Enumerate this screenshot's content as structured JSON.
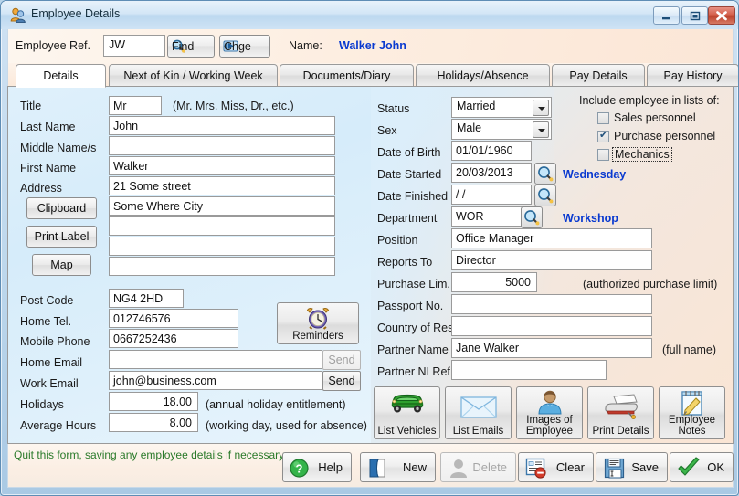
{
  "window": {
    "title": "Employee Details",
    "icon": "employees-icon",
    "controls": {
      "minimize": "minimize-icon",
      "maximize": "maximize-icon",
      "close": "close-icon"
    }
  },
  "header": {
    "employee_ref_label": "Employee Ref.",
    "employee_ref_value": "JW",
    "find_label": "Find",
    "chge_label": "Chge",
    "name_label": "Name:",
    "name_value": "Walker John"
  },
  "tabs": [
    {
      "label": "Details",
      "active": true
    },
    {
      "label": "Next of Kin / Working Week",
      "active": false
    },
    {
      "label": "Documents/Diary",
      "active": false
    },
    {
      "label": "Holidays/Absence",
      "active": false
    },
    {
      "label": "Pay Details",
      "active": false
    },
    {
      "label": "Pay History",
      "active": false
    }
  ],
  "left": {
    "title_label": "Title",
    "title_value": "Mr",
    "title_hint": "(Mr. Mrs. Miss, Dr., etc.)",
    "last_name_label": "Last Name",
    "last_name_value": "John",
    "middle_names_label": "Middle Name/s",
    "middle_names_value": "",
    "first_name_label": "First Name",
    "first_name_value": "Walker",
    "address_label": "Address",
    "address_lines": [
      "21 Some street",
      "Some Where City",
      "",
      "",
      ""
    ],
    "clipboard_label": "Clipboard",
    "print_label_label": "Print Label",
    "map_label": "Map",
    "post_code_label": "Post Code",
    "post_code_value": "NG4 2HD",
    "home_tel_label": "Home Tel.",
    "home_tel_value": "012746576",
    "mobile_phone_label": "Mobile Phone",
    "mobile_phone_value": "0667252436",
    "home_email_label": "Home Email",
    "home_email_value": "",
    "home_email_send_label": "Send",
    "work_email_label": "Work Email",
    "work_email_value": "john@business.com",
    "work_email_send_label": "Send",
    "holidays_label": "Holidays",
    "holidays_value": "18.00",
    "holidays_hint": "(annual holiday entitlement)",
    "average_hours_label": "Average Hours",
    "average_hours_value": "8.00",
    "average_hours_hint": "(working day, used for absence)",
    "reminders_label": "Reminders",
    "reminders_icon": "alarm-clock-icon"
  },
  "right": {
    "status_label": "Status",
    "status_value": "Married",
    "sex_label": "Sex",
    "sex_value": "Male",
    "dob_label": "Date of Birth",
    "dob_value": "01/01/1960",
    "date_started_label": "Date Started",
    "date_started_value": "20/03/2013",
    "date_started_day": "Wednesday",
    "date_finished_label": "Date Finished",
    "date_finished_value": "/  /",
    "department_label": "Department",
    "department_value": "WOR",
    "department_name": "Workshop",
    "position_label": "Position",
    "position_value": "Office Manager",
    "reports_to_label": "Reports To",
    "reports_to_value": "Director",
    "purchase_lim_label": "Purchase Lim.",
    "purchase_lim_value": "5000",
    "purchase_lim_hint": "(authorized purchase limit)",
    "passport_no_label": "Passport No.",
    "passport_no_value": "",
    "country_of_res_label": "Country of Res",
    "country_of_res_value": "",
    "partner_name_label": "Partner Name",
    "partner_name_value": "Jane Walker",
    "partner_name_hint": "(full name)",
    "partner_ni_label": "Partner NI Ref.",
    "partner_ni_value": ""
  },
  "include_lists": {
    "heading": "Include employee in lists of:",
    "items": [
      {
        "label": "Sales personnel",
        "checked": false,
        "focused": false
      },
      {
        "label": "Purchase personnel",
        "checked": true,
        "focused": false
      },
      {
        "label": "Mechanics",
        "checked": false,
        "focused": true
      }
    ]
  },
  "action_buttons": [
    {
      "label": "List Vehicles",
      "icon": "car-icon"
    },
    {
      "label": "List Emails",
      "icon": "envelope-icon"
    },
    {
      "label": "Images of Employee",
      "icon": "person-photo-icon"
    },
    {
      "label": "Print Details",
      "icon": "printer-icon"
    },
    {
      "label": "Employee Notes",
      "icon": "notepad-pencil-icon"
    }
  ],
  "footer": {
    "status_message": "Quit this form, saving any employee details if necessary.",
    "buttons": [
      {
        "label": "Help",
        "icon": "help-icon",
        "disabled": false
      },
      {
        "label": "New",
        "icon": "new-document-icon",
        "disabled": false
      },
      {
        "label": "Delete",
        "icon": "delete-person-icon",
        "disabled": true
      },
      {
        "label": "Clear",
        "icon": "clear-form-icon",
        "disabled": false
      },
      {
        "label": "Save",
        "icon": "save-disk-icon",
        "disabled": false
      },
      {
        "label": "OK",
        "icon": "checkmark-icon",
        "disabled": false
      }
    ]
  },
  "colors": {
    "accent_blue": "#0a3ad0",
    "status_green": "#2a7a2a",
    "close_red": "#bb3f29"
  }
}
